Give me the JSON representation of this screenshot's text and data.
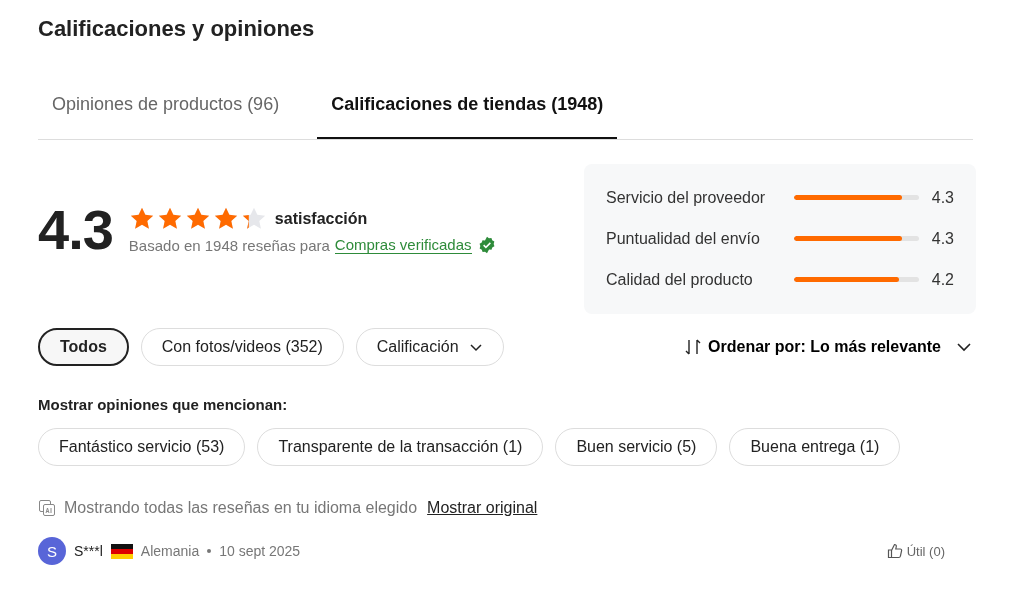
{
  "title": "Calificaciones y opiniones",
  "tabs": [
    {
      "label": "Opiniones de productos (96)",
      "selected": false
    },
    {
      "label": "Calificaciones de tiendas (1948)",
      "selected": true
    }
  ],
  "summary": {
    "score": "4.3",
    "stars": 4.3,
    "satisfaction": "satisfacción",
    "based_on": "Basado en 1948 reseñas para",
    "verified_link": "Compras verificadas"
  },
  "metrics": [
    {
      "name": "Servicio del proveedor",
      "level": 0.86,
      "reading": "4.3"
    },
    {
      "name": "Puntualidad del envío",
      "level": 0.86,
      "reading": "4.3"
    },
    {
      "name": "Calidad del producto",
      "level": 0.84,
      "reading": "4.2"
    }
  ],
  "filters": [
    {
      "label": "Todos",
      "selected": true,
      "kind": "chip"
    },
    {
      "label": "Con fotos/videos (352)",
      "selected": false,
      "kind": "chip"
    },
    {
      "label": "Calificación",
      "selected": false,
      "kind": "dropdown"
    }
  ],
  "sort": {
    "label": "Ordenar por: Lo más relevante"
  },
  "mentions": {
    "heading": "Mostrar opiniones que mencionan:",
    "tags": [
      {
        "label": "Fantástico servicio (53)",
        "selected": false
      },
      {
        "label": "Transparente de la transacción (1)",
        "selected": false
      },
      {
        "label": "Buen servicio (5)",
        "selected": false
      },
      {
        "label": "Buena entrega (1)",
        "selected": false
      }
    ]
  },
  "translation_note": {
    "text": "Mostrando todas las reseñas en tu idioma elegido",
    "link": "Mostrar original"
  },
  "review": {
    "avatar": "S",
    "author": "S***l",
    "country": "Alemania",
    "date": "10 sept 2025",
    "helpful": "Útil (0)"
  }
}
